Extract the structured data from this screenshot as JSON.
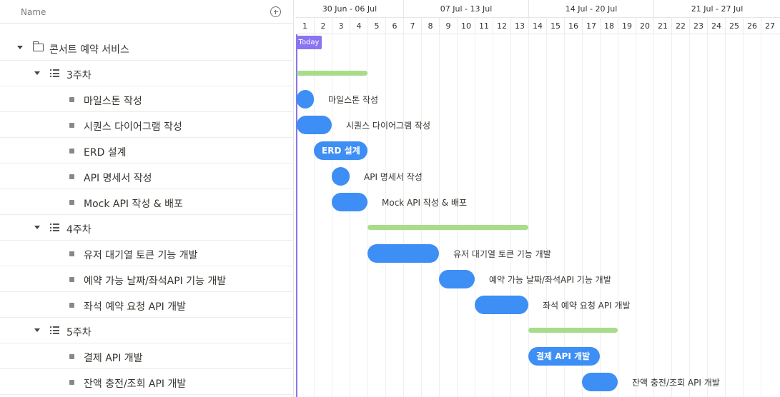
{
  "header": {
    "name_label": "Name",
    "add_icon": "plus-circle-icon"
  },
  "tree": {
    "project": "콘서트 예약 서비스",
    "groups": [
      {
        "label": "3주차",
        "tasks": [
          "마일스톤 작성",
          "시퀀스 다이어그램 작성",
          "ERD 설계",
          "API 명세서 작성",
          "Mock API 작성 & 배포"
        ]
      },
      {
        "label": "4주차",
        "tasks": [
          "유저 대기열 토큰 기능 개발",
          "예약 가능 날짜/좌석API 기능 개발",
          "좌석 예약 요청 API 개발"
        ]
      },
      {
        "label": "5주차",
        "tasks": [
          "결제 API 개발",
          "잔액 충전/조회 API 개발"
        ]
      }
    ]
  },
  "timeline": {
    "weeks": [
      "30 Jun - 06 Jul",
      "07 Jul - 13 Jul",
      "14 Jul - 20 Jul",
      "21 Jul - 27 Jul"
    ],
    "days": [
      "1",
      "2",
      "3",
      "4",
      "5",
      "6",
      "7",
      "8",
      "9",
      "10",
      "11",
      "12",
      "13",
      "14",
      "15",
      "16",
      "17",
      "18",
      "19",
      "20",
      "21",
      "22",
      "23",
      "24",
      "25",
      "26",
      "27"
    ],
    "today_label": "Today",
    "bars": {
      "t1": "마일스톤 작성",
      "t2": "시퀀스 다이어그램 작성",
      "t3": "ERD 설계",
      "t4": "API 명세서 작성",
      "t5": "Mock API 작성 & 배포",
      "t6": "유저 대기열 토큰 기능 개발",
      "t7": "예약 가능 날짜/좌석API 기능 개발",
      "t8": "좌석 예약 요청 API 개발",
      "t9": "결제 API 개발",
      "t10": "잔액 충전/조회 API 개발"
    }
  },
  "colors": {
    "task_bar": "#3d8ef5",
    "group_bar": "#a8dc8a",
    "today": "#8a74f0"
  }
}
